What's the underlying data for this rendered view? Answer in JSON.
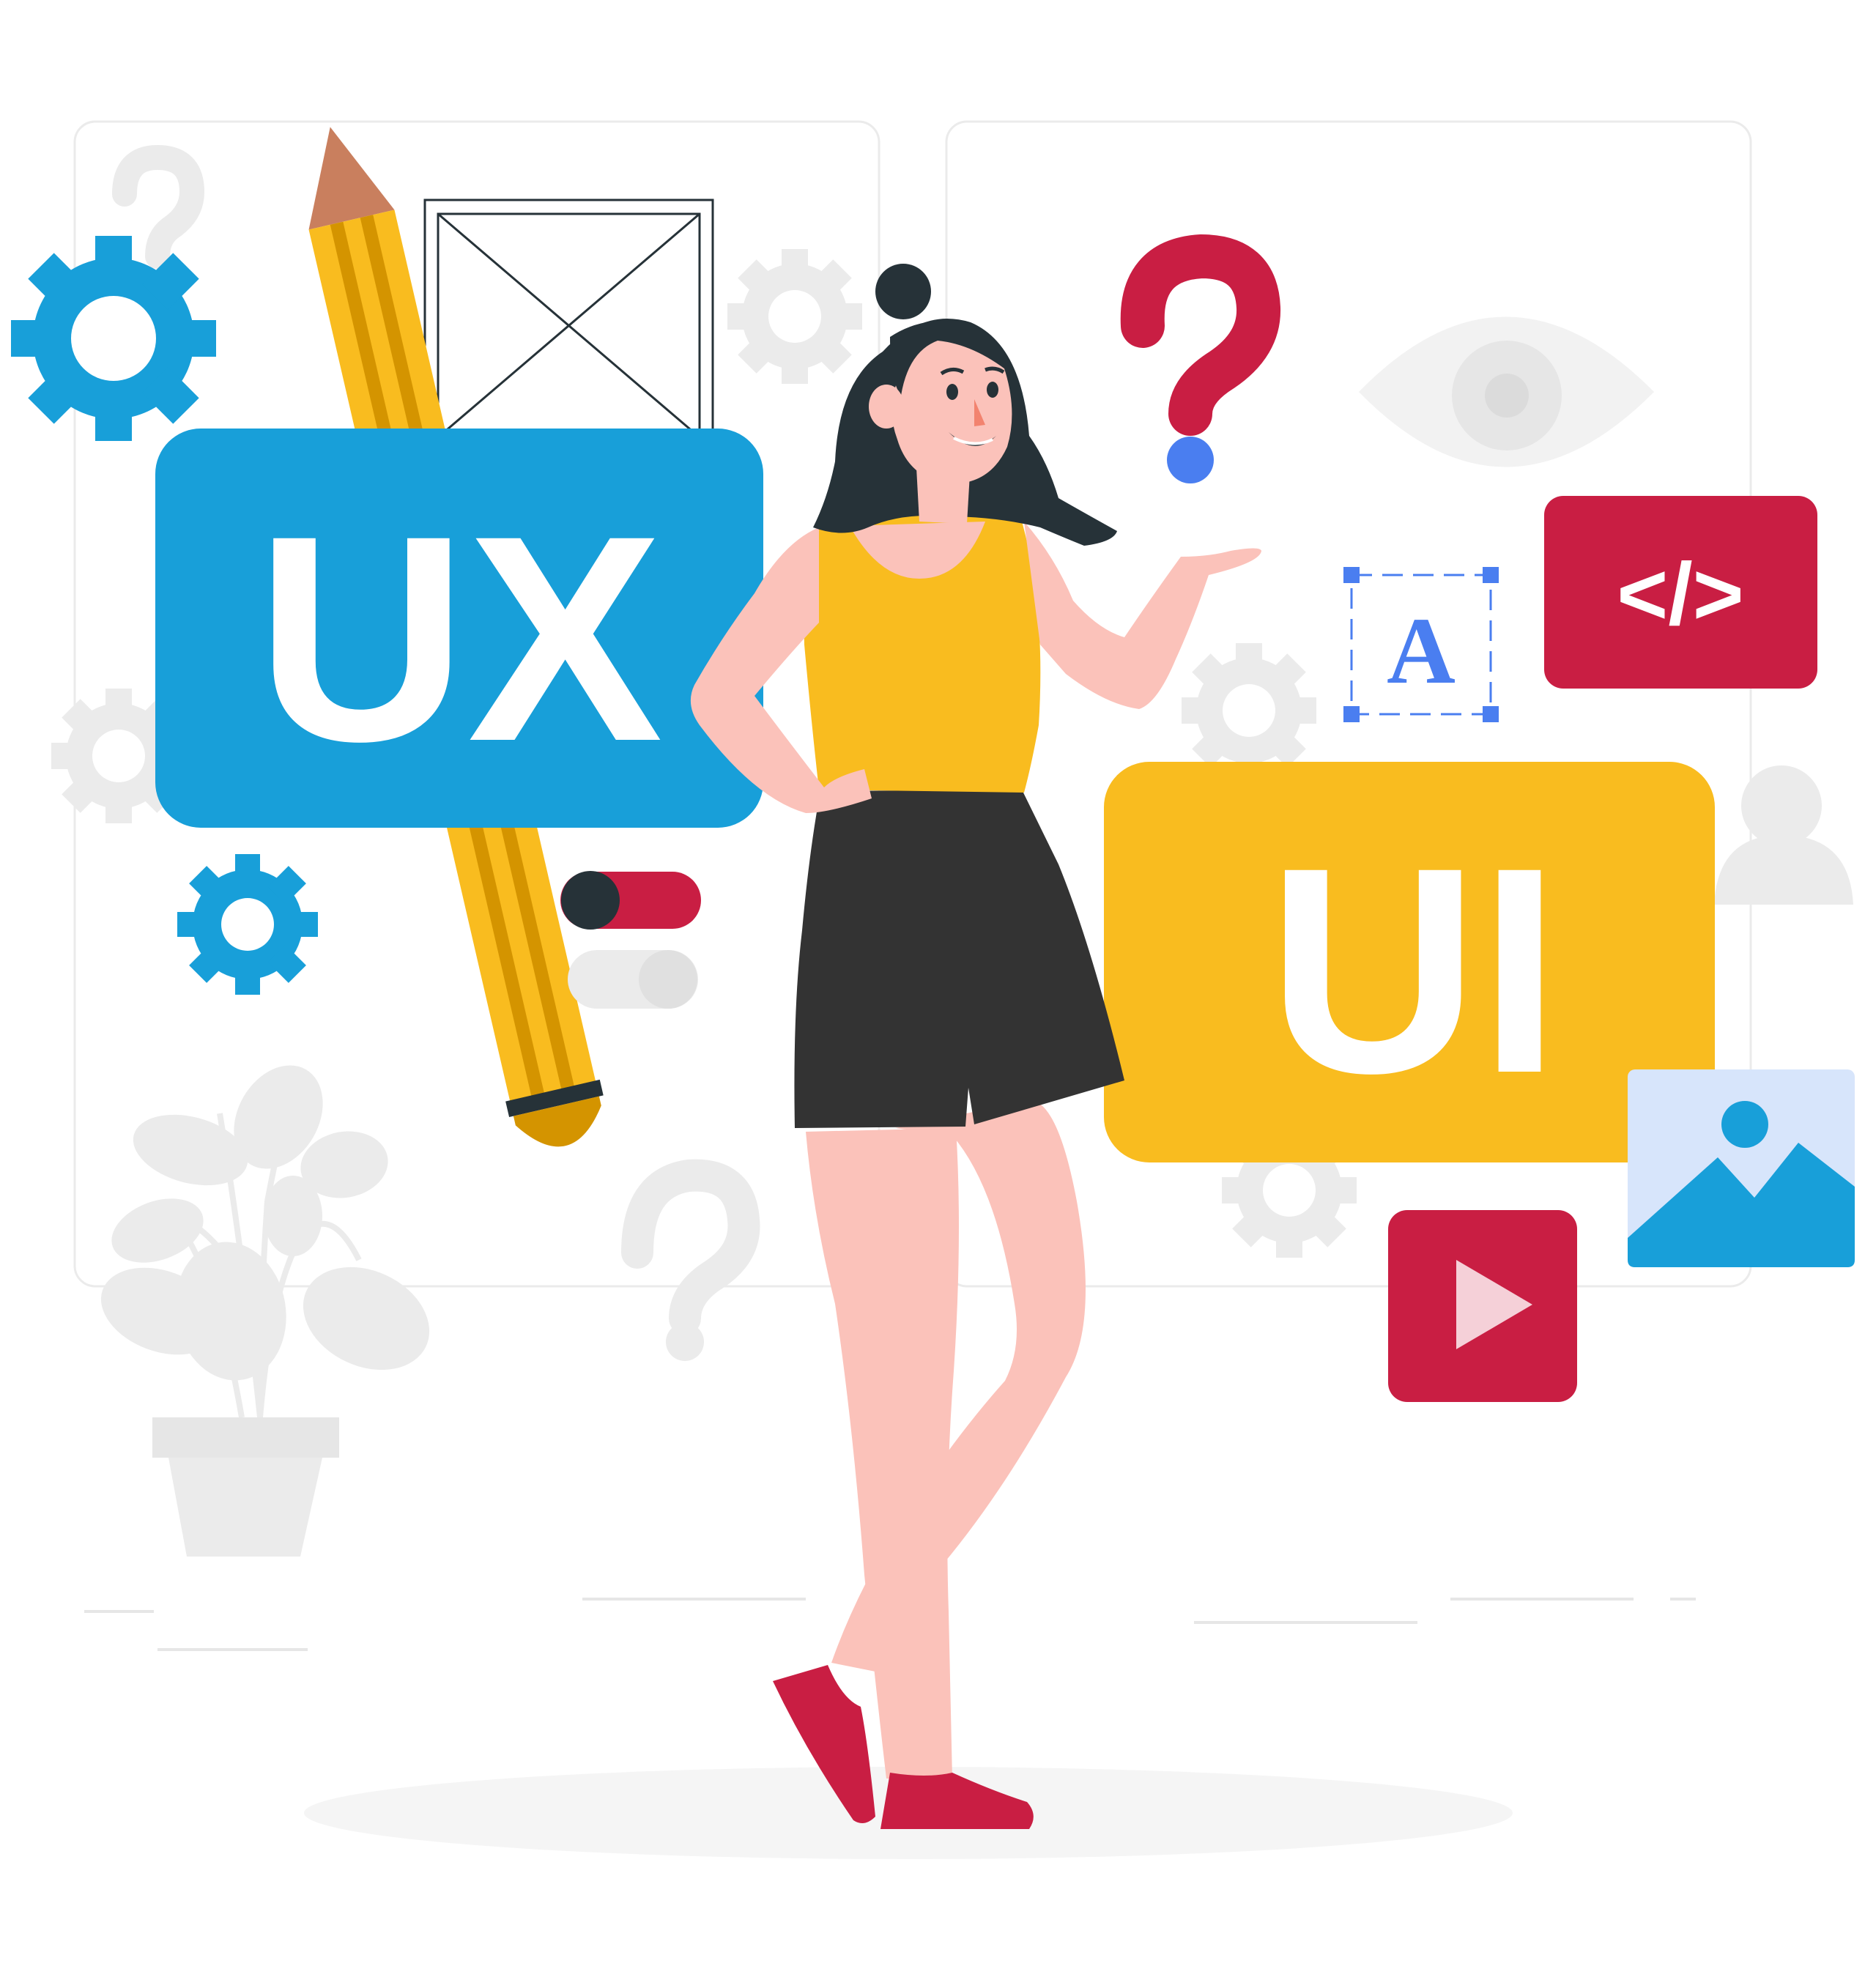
{
  "ux_card": {
    "label": "UX",
    "color": "#189fd9"
  },
  "ui_card": {
    "label": "UI",
    "color": "#f9bc1f"
  },
  "code_card": {
    "label": "</>",
    "color": "#c91e43"
  },
  "text_tool": {
    "glyph": "A",
    "color": "#4a7ef0"
  },
  "question_mark": {
    "glyph": "?",
    "color": "#c91e43",
    "dot_color": "#4a7ef0"
  },
  "toggle_on": {
    "state": "on",
    "color": "#c91e43"
  },
  "toggle_off": {
    "state": "off",
    "color": "#e6e6e6"
  },
  "video_card": {
    "icon": "play-icon",
    "color": "#c91e43"
  },
  "image_card": {
    "icon": "image-icon",
    "color": "#189fd9"
  },
  "person": {
    "top_color": "#f9bc1f",
    "shorts_color": "#333333",
    "shoes_color": "#c91e43",
    "skin_color": "#fbc2ba",
    "hair_color": "#263238"
  },
  "decor": {
    "accent_blue": "#189fd9",
    "neutral_gray": "#e6e6e6"
  }
}
